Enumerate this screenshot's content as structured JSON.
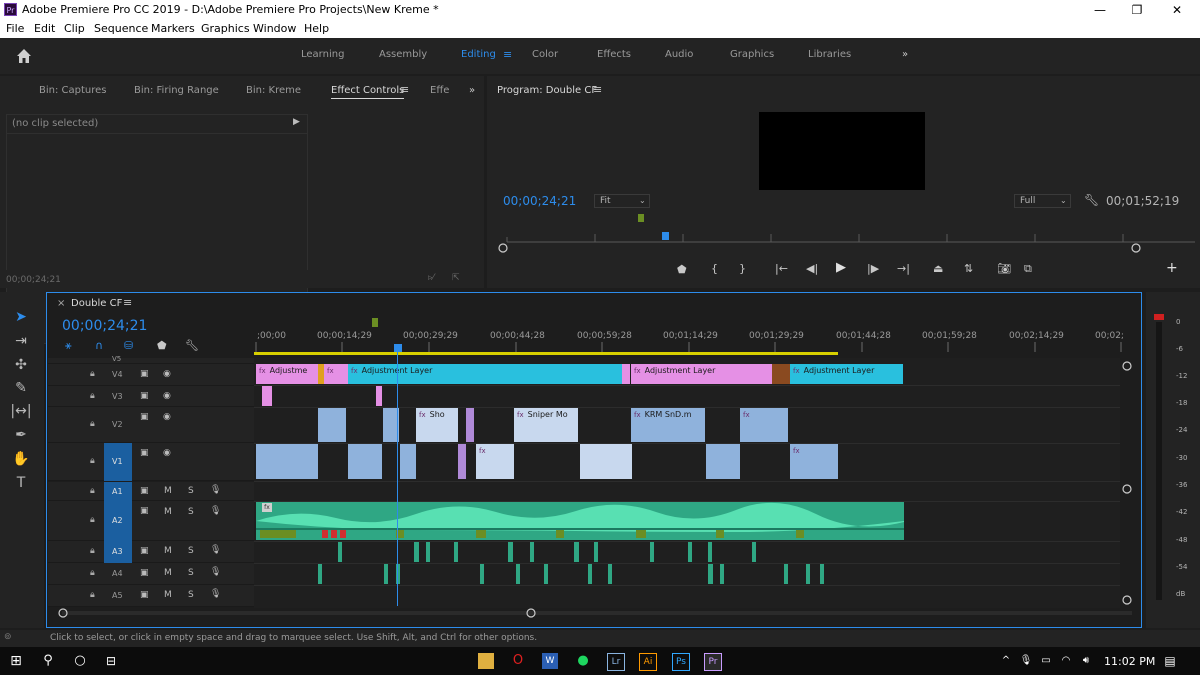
{
  "title_bar": {
    "app_icon": "Pr",
    "title": "Adobe Premiere Pro CC 2019 - D:\\Adobe Premiere Pro Projects\\New Kreme *",
    "minimize": "—",
    "maximize": "❐",
    "close": "✕"
  },
  "menu": [
    "File",
    "Edit",
    "Clip",
    "Sequence",
    "Markers",
    "Graphics",
    "Window",
    "Help"
  ],
  "workspaces": [
    "Learning",
    "Assembly",
    "Editing",
    "Color",
    "Effects",
    "Audio",
    "Graphics",
    "Libraries"
  ],
  "workspace_active": "Editing",
  "workspace_more": "»",
  "source_panel": {
    "tabs": [
      "Bin: Captures",
      "Bin: Firing Range",
      "Bin: Kreme",
      "Effect Controls",
      "Effe"
    ],
    "active_tab": "Effect Controls",
    "more": "»",
    "no_clip": "(no clip selected)",
    "timecode": "00;00;24;21"
  },
  "program_monitor": {
    "title": "Program: Double CF",
    "timecode": "00;00;24;21",
    "fit_label": "Fit",
    "quality_label": "Full",
    "duration": "00;01;52;19"
  },
  "timeline": {
    "sequence_name": "Double CF",
    "timecode": "00;00;24;21",
    "ruler_labels": [
      ";00;00",
      "00;00;14;29",
      "00;00;29;29",
      "00;00;44;28",
      "00;00;59;28",
      "00;01;14;29",
      "00;01;29;29",
      "00;01;44;28",
      "00;01;59;28",
      "00;02;14;29",
      "00;02;"
    ],
    "video_tracks": [
      "V5",
      "V4",
      "V3",
      "V2",
      "V1"
    ],
    "audio_tracks": [
      "A1",
      "A2",
      "A3",
      "A4",
      "A5"
    ],
    "track_m": "M",
    "track_s": "S",
    "clip_labels": {
      "adj1": "Adjustme",
      "adj2": "Adjustment Layer",
      "adj3": "Adjustment Layer",
      "adj4": "Adjustment Layer",
      "v2a": "Sho",
      "v2b": "Sniper Mo",
      "v2c": "KRM SnD.m"
    },
    "fx_badge": "fx"
  },
  "audio_meter": {
    "labels": [
      "0",
      "-6",
      "-12",
      "-18",
      "-24",
      "-30",
      "-36",
      "-42",
      "-48",
      "-54",
      "dB"
    ]
  },
  "status_bar": {
    "message": "Click to select, or click in empty space and drag to marquee select. Use Shift, Alt, and Ctrl for other options."
  },
  "taskbar": {
    "time": "11:02 PM",
    "app_labels": [
      "Lr",
      "Ai",
      "Ps",
      "Pr"
    ]
  },
  "colors": {
    "accent_blue": "#2d8ceb",
    "adjustment_clip": "#e590e5",
    "video_clip": "#8fb2dc",
    "audio_clip": "#3bbf8f"
  }
}
